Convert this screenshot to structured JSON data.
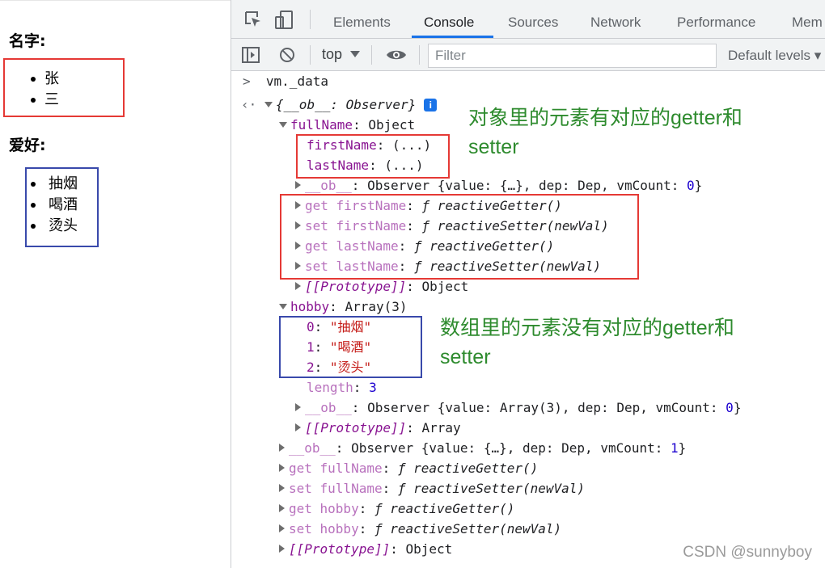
{
  "page": {
    "name_heading": "名字:",
    "names": [
      "张",
      "三"
    ],
    "hobby_heading": "爱好:",
    "hobbies": [
      "抽烟",
      "喝酒",
      "烫头"
    ]
  },
  "devtools": {
    "tabs": [
      "Elements",
      "Console",
      "Sources",
      "Network",
      "Performance",
      "Mem"
    ],
    "active_tab": "Console",
    "context": "top",
    "filter_placeholder": "Filter",
    "levels_label": "Default levels",
    "icons": [
      "inspect-icon",
      "device-toggle-icon",
      "sidebar-toggle-icon",
      "clear-console-icon",
      "eye-icon"
    ]
  },
  "console": {
    "input": "vm._data",
    "root_key": "{__ob__: Observer}",
    "info_badge": "i",
    "fullName_key": "fullName",
    "fullName_type": "Object",
    "firstName": "firstName",
    "lastName": "lastName",
    "lazy": "(...)",
    "ob_key": "__ob__",
    "ob_full": "Observer {value: {…}, dep: Dep, vmCount: ",
    "ob_full_count": "0",
    "get_first": "get firstName",
    "set_first": "set firstName",
    "get_last": "get lastName",
    "set_last": "set lastName",
    "f_symbol": "ƒ",
    "reactive_getter": "reactiveGetter()",
    "reactive_setter": "reactiveSetter(newVal)",
    "prototype_key": "[[Prototype]]",
    "object_label": "Object",
    "hobby_key": "hobby",
    "hobby_type": "Array(3)",
    "hobby_items": [
      {
        "idx": "0",
        "val": "\"抽烟\""
      },
      {
        "idx": "1",
        "val": "\"喝酒\""
      },
      {
        "idx": "2",
        "val": "\"烫头\""
      }
    ],
    "length_key": "length",
    "length_val": "3",
    "ob_hobby": "Observer {value: Array(3), dep: Dep, vmCount: ",
    "ob_hobby_count": "0",
    "array_label": "Array",
    "ob_root": "Observer {value: {…}, dep: Dep, vmCount: ",
    "ob_root_count": "1",
    "get_fullName": "get fullName",
    "set_fullName": "set fullName",
    "get_hobby": "get hobby",
    "set_hobby": "set hobby"
  },
  "annotations": {
    "object_note_1": "对象里的元素有对应的getter和",
    "object_note_2": "setter",
    "array_note_1": "数组里的元素没有对应的getter和",
    "array_note_2": "setter"
  },
  "watermark": "CSDN @sunnyboy",
  "colors": {
    "red_box": "#e53935",
    "blue_box": "#3949ab",
    "annotation": "#2e8b2e",
    "active_tab_underline": "#1a73e8"
  }
}
